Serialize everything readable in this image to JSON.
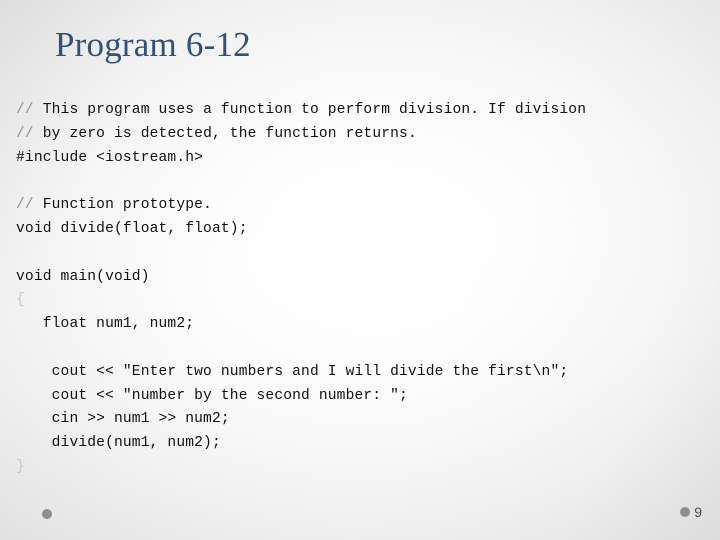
{
  "slide": {
    "title": "Program 6-12",
    "title_color": "#33507a",
    "background_color": "#f2f2f2",
    "accent_dot_color": "#8e8e8e"
  },
  "code": {
    "language": "cpp",
    "lines": [
      "// This program uses a function to perform division. If division",
      "// by zero is detected, the function returns.",
      "#include <iostream.h>",
      "",
      "// Function prototype.",
      "void divide(float, float);",
      "",
      "void main(void)",
      "{",
      "   float num1, num2;",
      "",
      "    cout << \"Enter two numbers and I will divide the first\\n\";",
      "    cout << \"number by the second number: \";",
      "    cin >> num1 >> num2;",
      "    divide(num1, num2);",
      "}"
    ]
  },
  "footer": {
    "page_number": "9",
    "left_bullet_icon": "circle-bullet-icon",
    "right_bullet_icon": "circle-bullet-icon"
  }
}
